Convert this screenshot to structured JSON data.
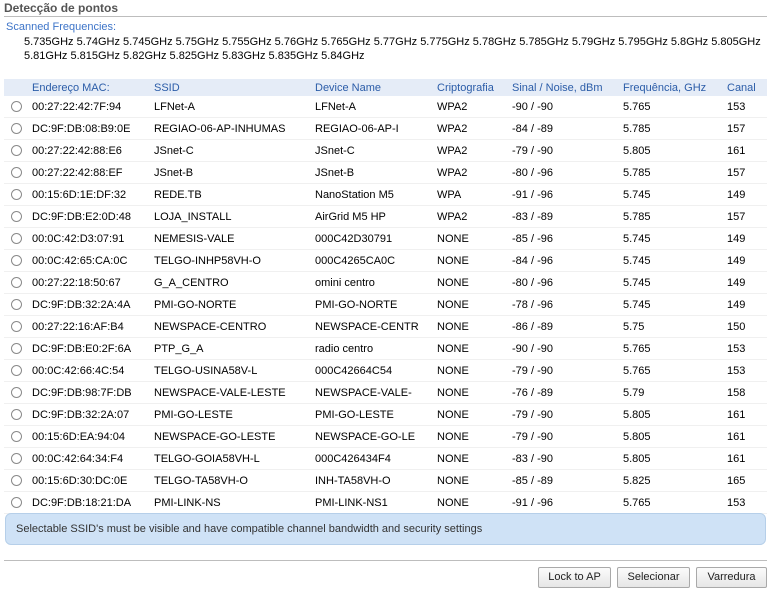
{
  "title": "Detecção de pontos",
  "scanned_label": "Scanned Frequencies:",
  "scanned_frequencies": "5.735GHz 5.74GHz 5.745GHz 5.75GHz 5.755GHz 5.76GHz 5.765GHz 5.77GHz 5.775GHz 5.78GHz 5.785GHz 5.79GHz 5.795GHz 5.8GHz 5.805GHz 5.81GHz 5.815GHz 5.82GHz 5.825GHz 5.83GHz 5.835GHz 5.84GHz",
  "table": {
    "headers": [
      "Endereço MAC:",
      "SSID",
      "Device Name",
      "Criptografia",
      "Sinal / Noise, dBm",
      "Frequência, GHz",
      "Canal"
    ],
    "rows": [
      [
        "00:27:22:42:7F:94",
        "LFNet-A",
        "LFNet-A",
        "WPA2",
        "-90 / -90",
        "5.765",
        "153"
      ],
      [
        "DC:9F:DB:08:B9:0E",
        "REGIAO-06-AP-INHUMAS",
        "REGIAO-06-AP-I",
        "WPA2",
        "-84 / -89",
        "5.785",
        "157"
      ],
      [
        "00:27:22:42:88:E6",
        "JSnet-C",
        "JSnet-C",
        "WPA2",
        "-79 / -90",
        "5.805",
        "161"
      ],
      [
        "00:27:22:42:88:EF",
        "JSnet-B",
        "JSnet-B",
        "WPA2",
        "-80 / -96",
        "5.785",
        "157"
      ],
      [
        "00:15:6D:1E:DF:32",
        "REDE.TB",
        "NanoStation M5",
        "WPA",
        "-91 / -96",
        "5.745",
        "149"
      ],
      [
        "DC:9F:DB:E2:0D:48",
        "LOJA_INSTALL",
        "AirGrid M5 HP",
        "WPA2",
        "-83 / -89",
        "5.785",
        "157"
      ],
      [
        "00:0C:42:D3:07:91",
        "NEMESIS-VALE",
        "000C42D30791",
        "NONE",
        "-85 / -96",
        "5.745",
        "149"
      ],
      [
        "00:0C:42:65:CA:0C",
        "TELGO-INHP58VH-O",
        "000C4265CA0C",
        "NONE",
        "-84 / -96",
        "5.745",
        "149"
      ],
      [
        "00:27:22:18:50:67",
        "G_A_CENTRO",
        "omini centro",
        "NONE",
        "-80 / -96",
        "5.745",
        "149"
      ],
      [
        "DC:9F:DB:32:2A:4A",
        "PMI-GO-NORTE",
        "PMI-GO-NORTE",
        "NONE",
        "-78 / -96",
        "5.745",
        "149"
      ],
      [
        "00:27:22:16:AF:B4",
        "NEWSPACE-CENTRO",
        "NEWSPACE-CENTR",
        "NONE",
        "-86 / -89",
        "5.75",
        "150"
      ],
      [
        "DC:9F:DB:E0:2F:6A",
        "PTP_G_A",
        "radio centro",
        "NONE",
        "-90 / -90",
        "5.765",
        "153"
      ],
      [
        "00:0C:42:66:4C:54",
        "TELGO-USINA58V-L",
        "000C42664C54",
        "NONE",
        "-79 / -90",
        "5.765",
        "153"
      ],
      [
        "DC:9F:DB:98:7F:DB",
        "NEWSPACE-VALE-LESTE",
        "NEWSPACE-VALE-",
        "NONE",
        "-76 / -89",
        "5.79",
        "158"
      ],
      [
        "DC:9F:DB:32:2A:07",
        "PMI-GO-LESTE",
        "PMI-GO-LESTE",
        "NONE",
        "-79 / -90",
        "5.805",
        "161"
      ],
      [
        "00:15:6D:EA:94:04",
        "NEWSPACE-GO-LESTE",
        "NEWSPACE-GO-LE",
        "NONE",
        "-79 / -90",
        "5.805",
        "161"
      ],
      [
        "00:0C:42:64:34:F4",
        "TELGO-GOIA58VH-L",
        "000C426434F4",
        "NONE",
        "-83 / -90",
        "5.805",
        "161"
      ],
      [
        "00:15:6D:30:DC:0E",
        "TELGO-TA58VH-O",
        "INH-TA58VH-O",
        "NONE",
        "-85 / -89",
        "5.825",
        "165"
      ],
      [
        "DC:9F:DB:18:21:DA",
        "PMI-LINK-NS",
        "PMI-LINK-NS1",
        "NONE",
        "-91 / -96",
        "5.765",
        "153"
      ]
    ]
  },
  "notice": "Selectable SSID's must be visible and have compatible channel bandwidth and security settings",
  "buttons": {
    "lock_to_ap": "Lock to AP",
    "selecionar": "Selecionar",
    "varredura": "Varredura"
  },
  "colors": {
    "header_bg": "#e5ecf7",
    "header_text": "#2b5ca8",
    "notice_bg": "#cfe2f6",
    "scan_label": "#3d74c8"
  }
}
